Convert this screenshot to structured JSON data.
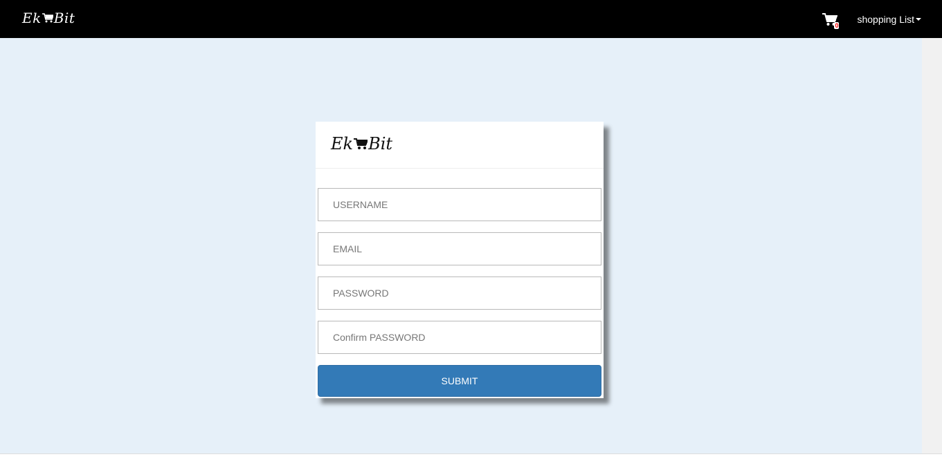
{
  "navbar": {
    "brand_left": "Ek",
    "brand_right": "Bit",
    "cart_icon": "shopping-cart-icon",
    "cart_count": "0",
    "shopping_list_label": "shopping List",
    "background_color": "#000000"
  },
  "form_card": {
    "logo_left": "Ek",
    "logo_right": "Bit",
    "username_placeholder": "USERNAME",
    "email_placeholder": "EMAIL",
    "password_placeholder": "PASSWORD",
    "confirm_password_placeholder": "Confirm PASSWORD",
    "submit_label": "SUBMIT",
    "submit_color": "#337ab7"
  },
  "page": {
    "background_color": "#e6f0f9"
  }
}
